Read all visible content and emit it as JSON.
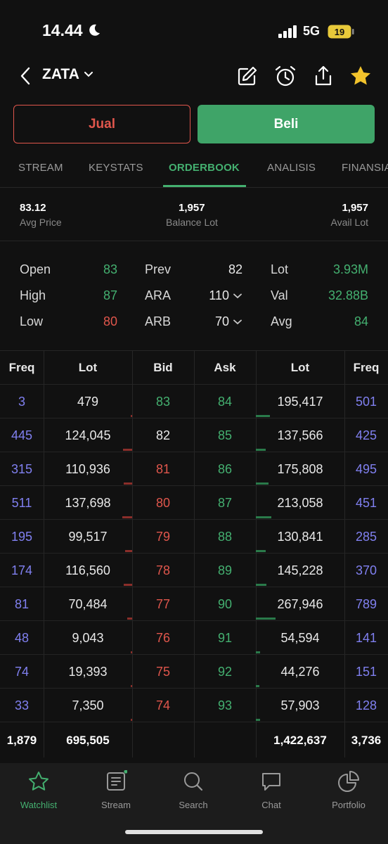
{
  "status_bar": {
    "time": "14.44",
    "network": "5G",
    "battery": "19"
  },
  "header": {
    "ticker": "ZATA"
  },
  "actions": {
    "sell_label": "Jual",
    "buy_label": "Beli"
  },
  "tabs": [
    {
      "label": "STREAM",
      "active": false
    },
    {
      "label": "KEYSTATS",
      "active": false
    },
    {
      "label": "ORDERBOOK",
      "active": true
    },
    {
      "label": "ANALISIS",
      "active": false
    },
    {
      "label": "FINANSIAL",
      "active": false
    }
  ],
  "summary": {
    "avg_price": {
      "value": "83.12",
      "label": "Avg Price"
    },
    "balance_lot": {
      "value": "1,957",
      "label": "Balance Lot"
    },
    "avail_lot": {
      "value": "1,957",
      "label": "Avail Lot"
    }
  },
  "stats": {
    "open": {
      "label": "Open",
      "value": "83"
    },
    "high": {
      "label": "High",
      "value": "87"
    },
    "low": {
      "label": "Low",
      "value": "80"
    },
    "prev": {
      "label": "Prev",
      "value": "82"
    },
    "ara": {
      "label": "ARA",
      "value": "110"
    },
    "arb": {
      "label": "ARB",
      "value": "70"
    },
    "lot": {
      "label": "Lot",
      "value": "3.93M"
    },
    "val": {
      "label": "Val",
      "value": "32.88B"
    },
    "avg": {
      "label": "Avg",
      "value": "84"
    }
  },
  "orderbook": {
    "headers": {
      "freq_bid": "Freq",
      "lot_bid": "Lot",
      "bid": "Bid",
      "ask": "Ask",
      "lot_ask": "Lot",
      "freq_ask": "Freq"
    },
    "rows": [
      {
        "freq_bid": "3",
        "lot_bid": "479",
        "bid": "83",
        "ask": "84",
        "lot_ask": "195,417",
        "freq_ask": "501"
      },
      {
        "freq_bid": "445",
        "lot_bid": "124,045",
        "bid": "82",
        "ask": "85",
        "lot_ask": "137,566",
        "freq_ask": "425"
      },
      {
        "freq_bid": "315",
        "lot_bid": "110,936",
        "bid": "81",
        "ask": "86",
        "lot_ask": "175,808",
        "freq_ask": "495"
      },
      {
        "freq_bid": "511",
        "lot_bid": "137,698",
        "bid": "80",
        "ask": "87",
        "lot_ask": "213,058",
        "freq_ask": "451"
      },
      {
        "freq_bid": "195",
        "lot_bid": "99,517",
        "bid": "79",
        "ask": "88",
        "lot_ask": "130,841",
        "freq_ask": "285"
      },
      {
        "freq_bid": "174",
        "lot_bid": "116,560",
        "bid": "78",
        "ask": "89",
        "lot_ask": "145,228",
        "freq_ask": "370"
      },
      {
        "freq_bid": "81",
        "lot_bid": "70,484",
        "bid": "77",
        "ask": "90",
        "lot_ask": "267,946",
        "freq_ask": "789"
      },
      {
        "freq_bid": "48",
        "lot_bid": "9,043",
        "bid": "76",
        "ask": "91",
        "lot_ask": "54,594",
        "freq_ask": "141"
      },
      {
        "freq_bid": "74",
        "lot_bid": "19,393",
        "bid": "75",
        "ask": "92",
        "lot_ask": "44,276",
        "freq_ask": "151"
      },
      {
        "freq_bid": "33",
        "lot_bid": "7,350",
        "bid": "74",
        "ask": "93",
        "lot_ask": "57,903",
        "freq_ask": "128"
      }
    ],
    "totals": {
      "freq_bid": "1,879",
      "lot_bid": "695,505",
      "lot_ask": "1,422,637",
      "freq_ask": "3,736"
    }
  },
  "bottom_nav": [
    {
      "label": "Watchlist",
      "icon": "star-outline-icon",
      "active": true
    },
    {
      "label": "Stream",
      "icon": "stream-icon",
      "active": false
    },
    {
      "label": "Search",
      "icon": "search-icon",
      "active": false
    },
    {
      "label": "Chat",
      "icon": "chat-icon",
      "active": false
    },
    {
      "label": "Portfolio",
      "icon": "pie-chart-icon",
      "active": false
    }
  ],
  "colors": {
    "up": "#44b070",
    "down": "#e0564c",
    "freq": "#8080f0",
    "background": "#111111"
  }
}
